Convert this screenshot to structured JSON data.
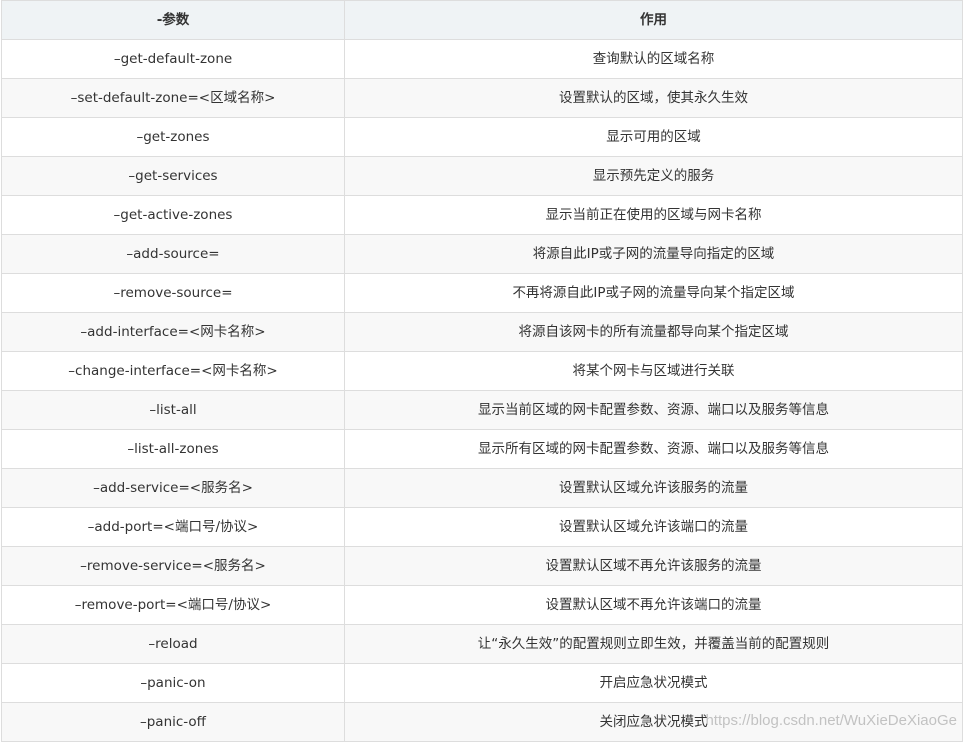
{
  "table": {
    "headers": [
      "-参数",
      "作用"
    ],
    "rows": [
      [
        "–get-default-zone",
        "查询默认的区域名称"
      ],
      [
        "–set-default-zone=<区域名称>",
        "设置默认的区域，使其永久生效"
      ],
      [
        "–get-zones",
        "显示可用的区域"
      ],
      [
        "–get-services",
        "显示预先定义的服务"
      ],
      [
        "–get-active-zones",
        "显示当前正在使用的区域与网卡名称"
      ],
      [
        "–add-source=",
        "将源自此IP或子网的流量导向指定的区域"
      ],
      [
        "–remove-source=",
        "不再将源自此IP或子网的流量导向某个指定区域"
      ],
      [
        "–add-interface=<网卡名称>",
        "将源自该网卡的所有流量都导向某个指定区域"
      ],
      [
        "–change-interface=<网卡名称>",
        "将某个网卡与区域进行关联"
      ],
      [
        "–list-all",
        "显示当前区域的网卡配置参数、资源、端口以及服务等信息"
      ],
      [
        "–list-all-zones",
        "显示所有区域的网卡配置参数、资源、端口以及服务等信息"
      ],
      [
        "–add-service=<服务名>",
        "设置默认区域允许该服务的流量"
      ],
      [
        "–add-port=<端口号/协议>",
        "设置默认区域允许该端口的流量"
      ],
      [
        "–remove-service=<服务名>",
        "设置默认区域不再允许该服务的流量"
      ],
      [
        "–remove-port=<端口号/协议>",
        "设置默认区域不再允许该端口的流量"
      ],
      [
        "–reload",
        "让“永久生效”的配置规则立即生效，并覆盖当前的配置规则"
      ],
      [
        "–panic-on",
        "开启应急状况模式"
      ],
      [
        "–panic-off",
        "关闭应急状况模式"
      ]
    ]
  },
  "watermark": "https://blog.csdn.net/WuXieDeXiaoGe"
}
